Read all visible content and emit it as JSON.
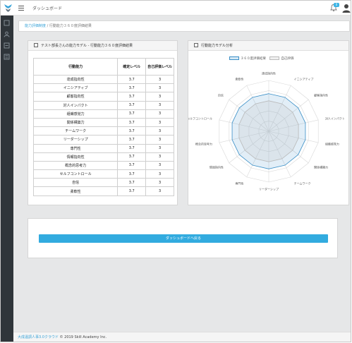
{
  "header": {
    "app_title": "ダッシュボード",
    "notification_count": "0"
  },
  "breadcrumb": {
    "root": "能力評価制度",
    "separator": "/",
    "current": "行動能力３６０度評価結果"
  },
  "result_card": {
    "title": "テスト部長さんの能力モデル - 行動能力３６０度評価結果",
    "columns": [
      "行動能力",
      "確定レベル",
      "自己評価レベル"
    ],
    "rows": [
      {
        "name": "達成指向性",
        "confirmed": "3.7",
        "self": "3"
      },
      {
        "name": "イニシアティブ",
        "confirmed": "3.7",
        "self": "3"
      },
      {
        "name": "顧客指向性",
        "confirmed": "3.7",
        "self": "3"
      },
      {
        "name": "対人インパクト",
        "confirmed": "3.7",
        "self": "3"
      },
      {
        "name": "組織感覚力",
        "confirmed": "3.7",
        "self": "3"
      },
      {
        "name": "関係構築力",
        "confirmed": "3.7",
        "self": "3"
      },
      {
        "name": "チームワーク",
        "confirmed": "3.7",
        "self": "3"
      },
      {
        "name": "リーダーシップ",
        "confirmed": "3.7",
        "self": "3"
      },
      {
        "name": "専門性",
        "confirmed": "3.7",
        "self": "3"
      },
      {
        "name": "情報指向性",
        "confirmed": "3.7",
        "self": "3"
      },
      {
        "name": "概念的思考力",
        "confirmed": "3.7",
        "self": "3"
      },
      {
        "name": "セルフコントロール",
        "confirmed": "3.7",
        "self": "3"
      },
      {
        "name": "自信",
        "confirmed": "3.7",
        "self": "3"
      },
      {
        "name": "柔軟性",
        "confirmed": "3.7",
        "self": "3"
      }
    ]
  },
  "analysis_card": {
    "title": "行動能力モデル分析"
  },
  "chart_data": {
    "type": "radar",
    "categories": [
      "達成指向性",
      "イニシアティブ",
      "顧客指向性",
      "対人インパクト",
      "組織感覚力",
      "関係構築力",
      "チームワーク",
      "リーダーシップ",
      "専門性",
      "情報指向性",
      "概念的思考力",
      "セルフコントロール",
      "自信",
      "柔軟性"
    ],
    "series": [
      {
        "name": "３６０度評価結果",
        "values": [
          3.7,
          3.7,
          3.7,
          3.7,
          3.7,
          3.7,
          3.7,
          3.7,
          3.7,
          3.7,
          3.7,
          3.7,
          3.7,
          3.7
        ],
        "color": "#3a8fc7"
      },
      {
        "name": "自己評価",
        "values": [
          3,
          3,
          3,
          3,
          3,
          3,
          3,
          3,
          3,
          3,
          3,
          3,
          3,
          3
        ],
        "color": "#bbbbbb"
      }
    ],
    "rlim": [
      0,
      5
    ],
    "grid": true,
    "legend": "top"
  },
  "actions": {
    "back_label": "ダッシュボードへ戻る"
  },
  "footer": {
    "link": "大成温調人事3.0クラウド",
    "copyright": "© 2019 Skill Academy Inc."
  },
  "colors": {
    "accent": "#32abdf",
    "sidebar": "#2f353a",
    "series_360": "#3a8fc7"
  }
}
